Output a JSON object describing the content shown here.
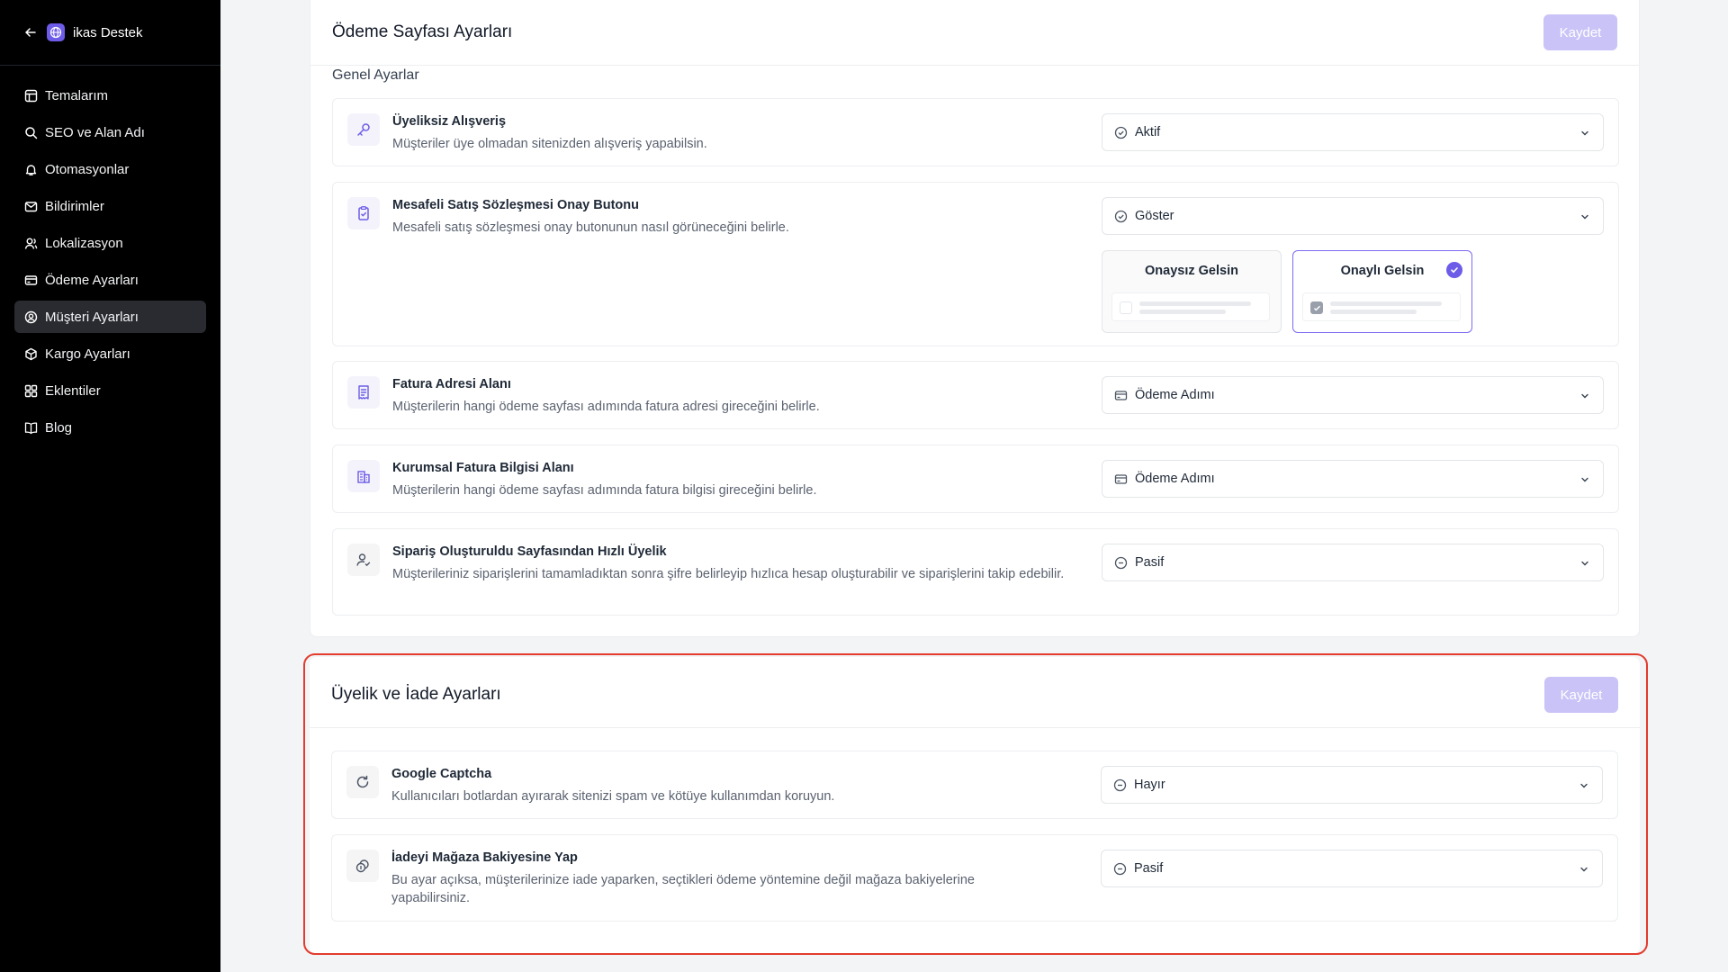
{
  "sidebar": {
    "title": "ikas Destek",
    "items": [
      {
        "label": "Temalarım",
        "icon": "layout-icon"
      },
      {
        "label": "SEO ve Alan Adı",
        "icon": "search-icon"
      },
      {
        "label": "Otomasyonlar",
        "icon": "bell-icon"
      },
      {
        "label": "Bildirimler",
        "icon": "mail-icon"
      },
      {
        "label": "Lokalizasyon",
        "icon": "users-icon"
      },
      {
        "label": "Ödeme Ayarları",
        "icon": "credit-card-icon"
      },
      {
        "label": "Müşteri Ayarları",
        "icon": "user-circle-icon",
        "active": true
      },
      {
        "label": "Kargo Ayarları",
        "icon": "package-icon"
      },
      {
        "label": "Eklentiler",
        "icon": "grid-icon"
      },
      {
        "label": "Blog",
        "icon": "book-icon"
      }
    ]
  },
  "checkout_card": {
    "title": "Ödeme Sayfası Ayarları",
    "save_label": "Kaydet",
    "section_label": "Genel Ayarlar",
    "rows": [
      {
        "title": "Üyeliksiz Alışveriş",
        "desc": "Müşteriler üye olmadan sitenizden alışveriş yapabilsin.",
        "value": "Aktif",
        "value_icon": "check-circle-icon",
        "icon": "key-icon"
      },
      {
        "title": "Mesafeli Satış Sözleşmesi Onay Butonu",
        "desc": "Mesafeli satış sözleşmesi onay butonunun nasıl görüneceğini belirle.",
        "value": "Göster",
        "value_icon": "check-circle-icon",
        "icon": "clipboard-check-icon",
        "options": [
          {
            "label": "Onaysız Gelsin",
            "selected": false
          },
          {
            "label": "Onaylı Gelsin",
            "selected": true
          }
        ]
      },
      {
        "title": "Fatura Adresi Alanı",
        "desc": "Müşterilerin hangi ödeme sayfası adımında fatura adresi gireceğini belirle.",
        "value": "Ödeme Adımı",
        "value_icon": "credit-card-icon",
        "icon": "receipt-icon"
      },
      {
        "title": "Kurumsal Fatura Bilgisi Alanı",
        "desc": "Müşterilerin hangi ödeme sayfası adımında fatura bilgisi gireceğini belirle.",
        "value": "Ödeme Adımı",
        "value_icon": "credit-card-icon",
        "icon": "building-icon"
      },
      {
        "title": "Sipariş Oluşturuldu Sayfasından Hızlı Üyelik",
        "desc": "Müşterileriniz siparişlerini tamamladıktan sonra şifre belirleyip hızlıca hesap oluşturabilir ve siparişlerini takip edebilir.",
        "value": "Pasif",
        "value_icon": "minus-circle-icon",
        "icon": "user-check-icon"
      }
    ]
  },
  "membership_card": {
    "title": "Üyelik ve İade Ayarları",
    "save_label": "Kaydet",
    "rows": [
      {
        "title": "Google Captcha",
        "desc": "Kullanıcıları botlardan ayırarak sitenizi spam ve kötüye kullanımdan koruyun.",
        "value": "Hayır",
        "value_icon": "minus-circle-icon",
        "icon": "refresh-icon"
      },
      {
        "title": "İadeyi Mağaza Bakiyesine Yap",
        "desc": "Bu ayar açıksa, müşterilerinize iade yaparken, seçtikleri ödeme yöntemine değil mağaza bakiyelerine yapabilirsiniz.",
        "value": "Pasif",
        "value_icon": "minus-circle-icon",
        "icon": "coins-icon"
      }
    ]
  },
  "colors": {
    "accent": "#6d5ce7",
    "save_disabled": "#c9c3f7",
    "highlight": "#e33b2e",
    "sidebar_bg": "#000000"
  }
}
